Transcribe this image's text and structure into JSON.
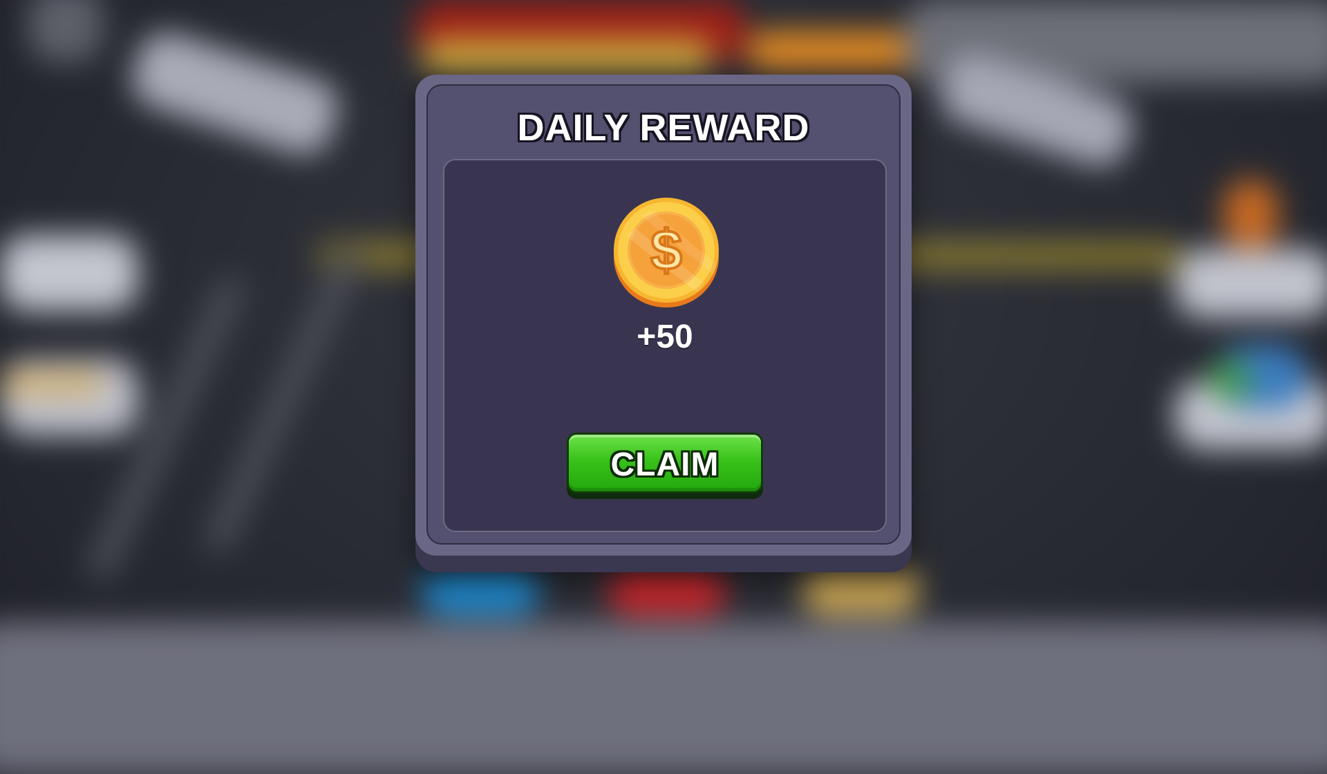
{
  "dialog": {
    "title": "DAILY REWARD",
    "reward": {
      "icon": "gold-coin-icon",
      "symbol": "$",
      "amount": "+50"
    },
    "claim_label": "CLAIM"
  },
  "colors": {
    "panel": "#54506f",
    "content": "#393550",
    "claim_button": "#38c21a",
    "coin": "#f6b632"
  }
}
